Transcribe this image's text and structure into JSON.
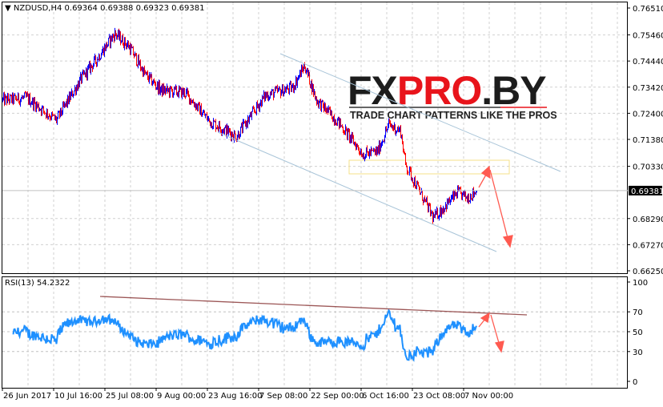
{
  "header": {
    "symbol": "NZDUSD,H4",
    "ohlc": "0.69364 0.69388 0.69323 0.69381"
  },
  "rsi_label": "RSI(13) 54.2322",
  "logo": {
    "part1": "FX",
    "part2": "PRO",
    "part3": ".BY",
    "tagline": "TRADE CHART PATTERNS LIKE THE PROS"
  },
  "colors": {
    "up": "#0000ff",
    "down": "#ff0000",
    "rsi": "#1e90ff",
    "channel": "#a8c4d8",
    "resistance": "#8b3a3a",
    "arrow": "#ff5a50",
    "zone": "#f5e08a"
  },
  "chart_data": [
    {
      "type": "candlestick",
      "title": "NZDUSD,H4",
      "ylim": [
        0.6625,
        0.7651
      ],
      "y_ticks": [
        "0.76510",
        "0.75460",
        "0.74440",
        "0.73420",
        "0.72400",
        "0.71380",
        "0.70330",
        "0.68290",
        "0.67270",
        "0.66250"
      ],
      "current_price": "0.69381",
      "x_ticks": [
        "26 Jun 2017",
        "10 Jul 16:00",
        "25 Jul 08:00",
        "9 Aug 00:00",
        "23 Aug 16:00",
        "7 Sep 08:00",
        "22 Sep 00:00",
        "6 Oct 16:00",
        "23 Oct 08:00",
        "7 Nov 00:00"
      ],
      "price_path": [
        [
          0,
          0.7291
        ],
        [
          30,
          0.73
        ],
        [
          67,
          0.7213
        ],
        [
          97,
          0.737
        ],
        [
          117,
          0.745
        ],
        [
          140,
          0.7551
        ],
        [
          158,
          0.75
        ],
        [
          178,
          0.739
        ],
        [
          198,
          0.733
        ],
        [
          228,
          0.732
        ],
        [
          258,
          0.721
        ],
        [
          292,
          0.715
        ],
        [
          328,
          0.731
        ],
        [
          362,
          0.734
        ],
        [
          377,
          0.7426
        ],
        [
          392,
          0.729
        ],
        [
          418,
          0.721
        ],
        [
          450,
          0.708
        ],
        [
          468,
          0.709
        ],
        [
          482,
          0.7195
        ],
        [
          497,
          0.717
        ],
        [
          503,
          0.704
        ],
        [
          518,
          0.695
        ],
        [
          538,
          0.6831
        ],
        [
          553,
          0.688
        ],
        [
          568,
          0.693
        ],
        [
          580,
          0.691
        ],
        [
          592,
          0.6938
        ]
      ]
    },
    {
      "type": "line",
      "title": "RSI(13)",
      "ylim": [
        0,
        100
      ],
      "y_ticks": [
        "100",
        "70",
        "50",
        "30",
        "0"
      ],
      "last_value": 54.2322
    }
  ]
}
